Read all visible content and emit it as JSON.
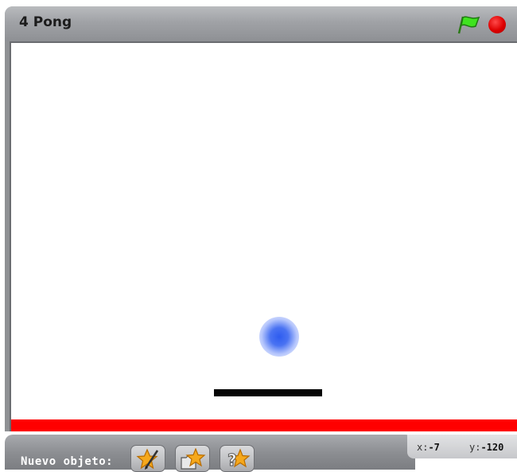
{
  "window": {
    "title": "4 Pong"
  },
  "controls": {
    "green_flag_icon": "green-flag-icon",
    "stop_icon": "stop-sign-icon"
  },
  "stage": {
    "background": "#ffffff",
    "boundary_color": "#ff0000",
    "ball_color": "#2e5cf0",
    "paddle_color": "#000000"
  },
  "sprite_tools": {
    "label": "Nuevo objeto:",
    "buttons": [
      {
        "icon": "paint-new-sprite-icon"
      },
      {
        "icon": "sprite-from-file-icon"
      },
      {
        "icon": "surprise-sprite-icon"
      }
    ]
  },
  "mouse_position": {
    "x_label": "x:",
    "x_value": "-7",
    "y_label": "y:",
    "y_value": "-120"
  }
}
